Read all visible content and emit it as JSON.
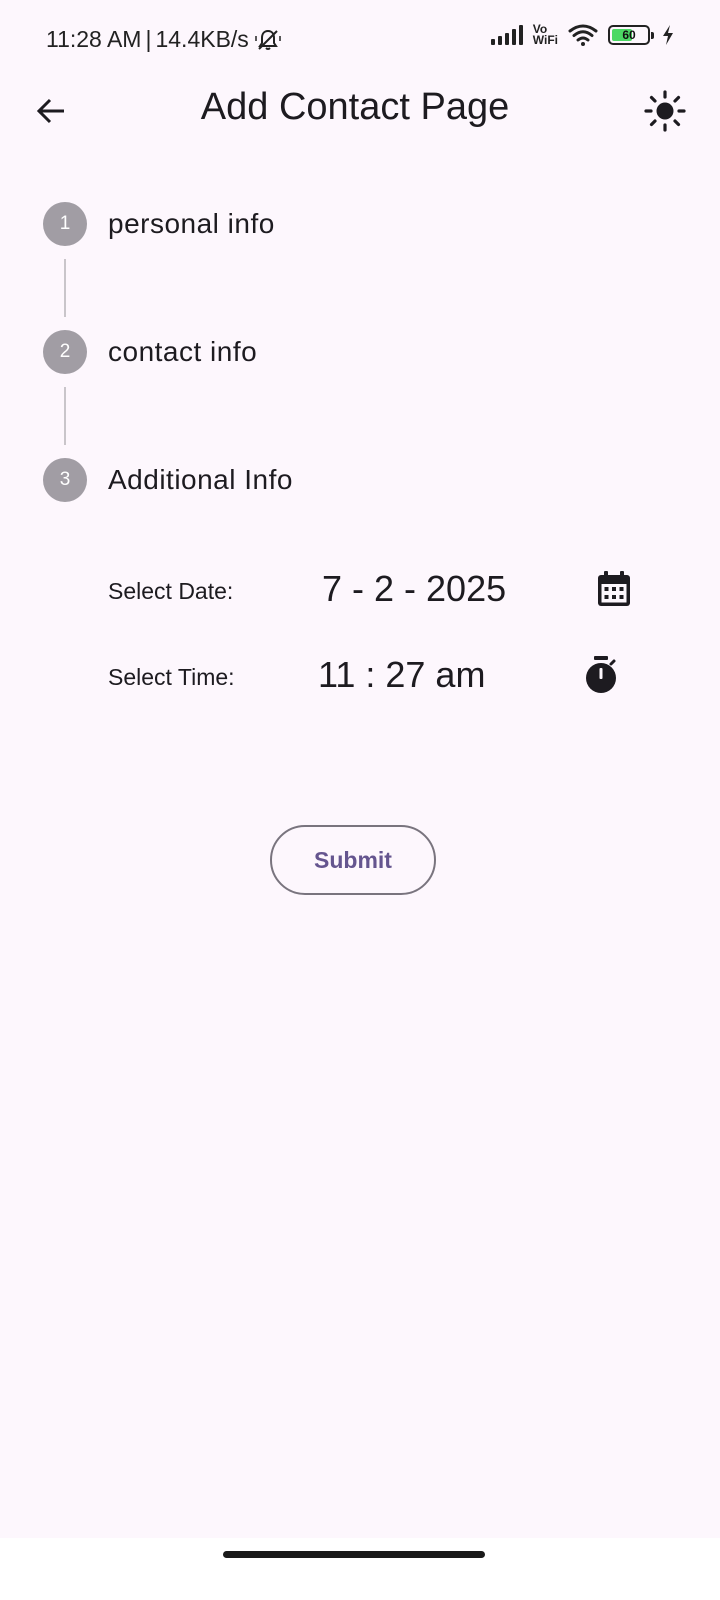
{
  "status_bar": {
    "time": "11:28 AM",
    "separator": "|",
    "network_speed": "14.4KB/s",
    "vowifi_top": "Vo",
    "vowifi_bottom": "WiFi",
    "battery_level": "60",
    "battery_fraction": 0.6,
    "battery_color": "#4cd964",
    "icons": [
      "bell-muted-icon",
      "signal-bars-icon",
      "wifi-icon",
      "battery-icon",
      "charging-bolt-icon"
    ]
  },
  "app_bar": {
    "title": "Add Contact Page",
    "back_icon": "arrow-back-icon",
    "theme_icon": "sun-icon"
  },
  "stepper": {
    "steps": [
      {
        "number": "1",
        "label": "personal info"
      },
      {
        "number": "2",
        "label": "contact info"
      },
      {
        "number": "3",
        "label": "Additional Info"
      }
    ],
    "circle_color": "#a19da4"
  },
  "additional_info": {
    "date_label": "Select Date:",
    "date_value": "7 - 2 - 2025",
    "date_icon": "calendar-icon",
    "time_label": "Select Time:",
    "time_value": "11 : 27 am",
    "time_icon": "stopwatch-icon"
  },
  "actions": {
    "submit_label": "Submit",
    "submit_color": "#65558f"
  },
  "colors": {
    "background": "#fdf7fd",
    "text": "#1d1b20",
    "outline": "#79747e"
  }
}
